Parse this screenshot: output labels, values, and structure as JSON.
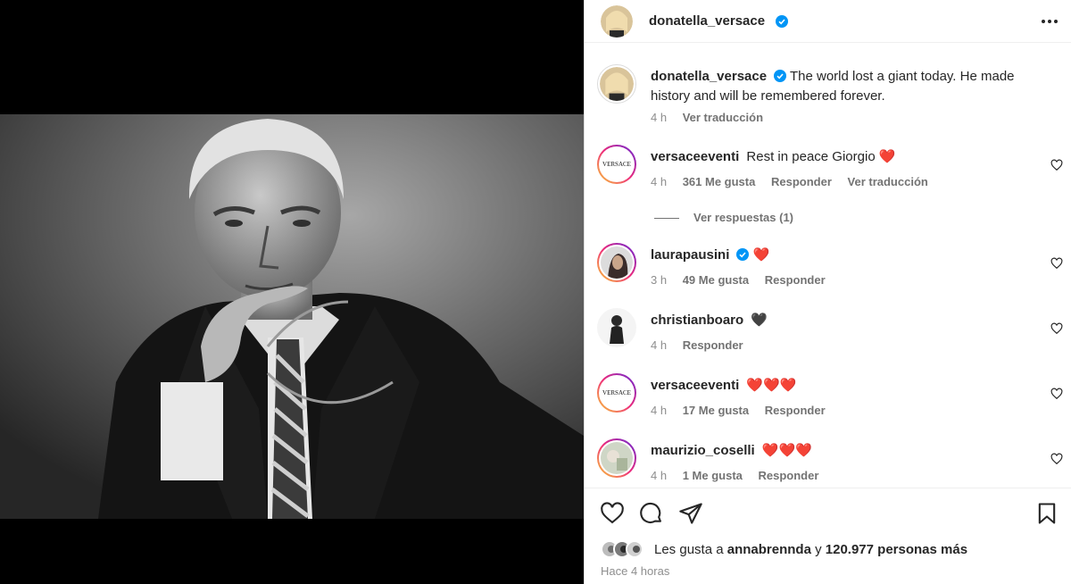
{
  "post": {
    "author": "donatella_versace",
    "caption": "The world lost a giant today. He made history and will be remembered forever.",
    "caption_time": "4 h",
    "caption_translate": "Ver traducción"
  },
  "comments": [
    {
      "user": "versaceeventi",
      "text": "Rest in peace Giorgio ❤️",
      "time": "4 h",
      "likes": "361 Me gusta",
      "reply": "Responder",
      "translate": "Ver traducción",
      "avatar_label": "VERSACE"
    },
    {
      "user": "laurapausini",
      "text": "❤️",
      "time": "3 h",
      "likes": "49 Me gusta",
      "reply": "Responder"
    },
    {
      "user": "christianboaro",
      "text": "🖤",
      "time": "4 h",
      "reply": "Responder"
    },
    {
      "user": "versaceeventi",
      "text": "❤️❤️❤️",
      "time": "4 h",
      "likes": "17 Me gusta",
      "reply": "Responder",
      "avatar_label": "VERSACE"
    },
    {
      "user": "maurizio_coselli",
      "text": "❤️❤️❤️",
      "time": "4 h",
      "likes": "1 Me gusta",
      "reply": "Responder"
    }
  ],
  "view_replies": "Ver respuestas (1)",
  "likes_summary": {
    "prefix": "Les gusta a",
    "user": "annabrennda",
    "conj": "y",
    "others": "120.977 personas más"
  },
  "posted_ago": "Hace 4 horas",
  "icons": {
    "more": "more-icon",
    "like": "heart-icon",
    "comment": "comment-icon",
    "share": "share-icon",
    "save": "bookmark-icon",
    "verified": "verified-badge-icon"
  },
  "colors": {
    "verified": "#0095f6",
    "text": "#262626",
    "secondary": "#8e8e8e"
  }
}
